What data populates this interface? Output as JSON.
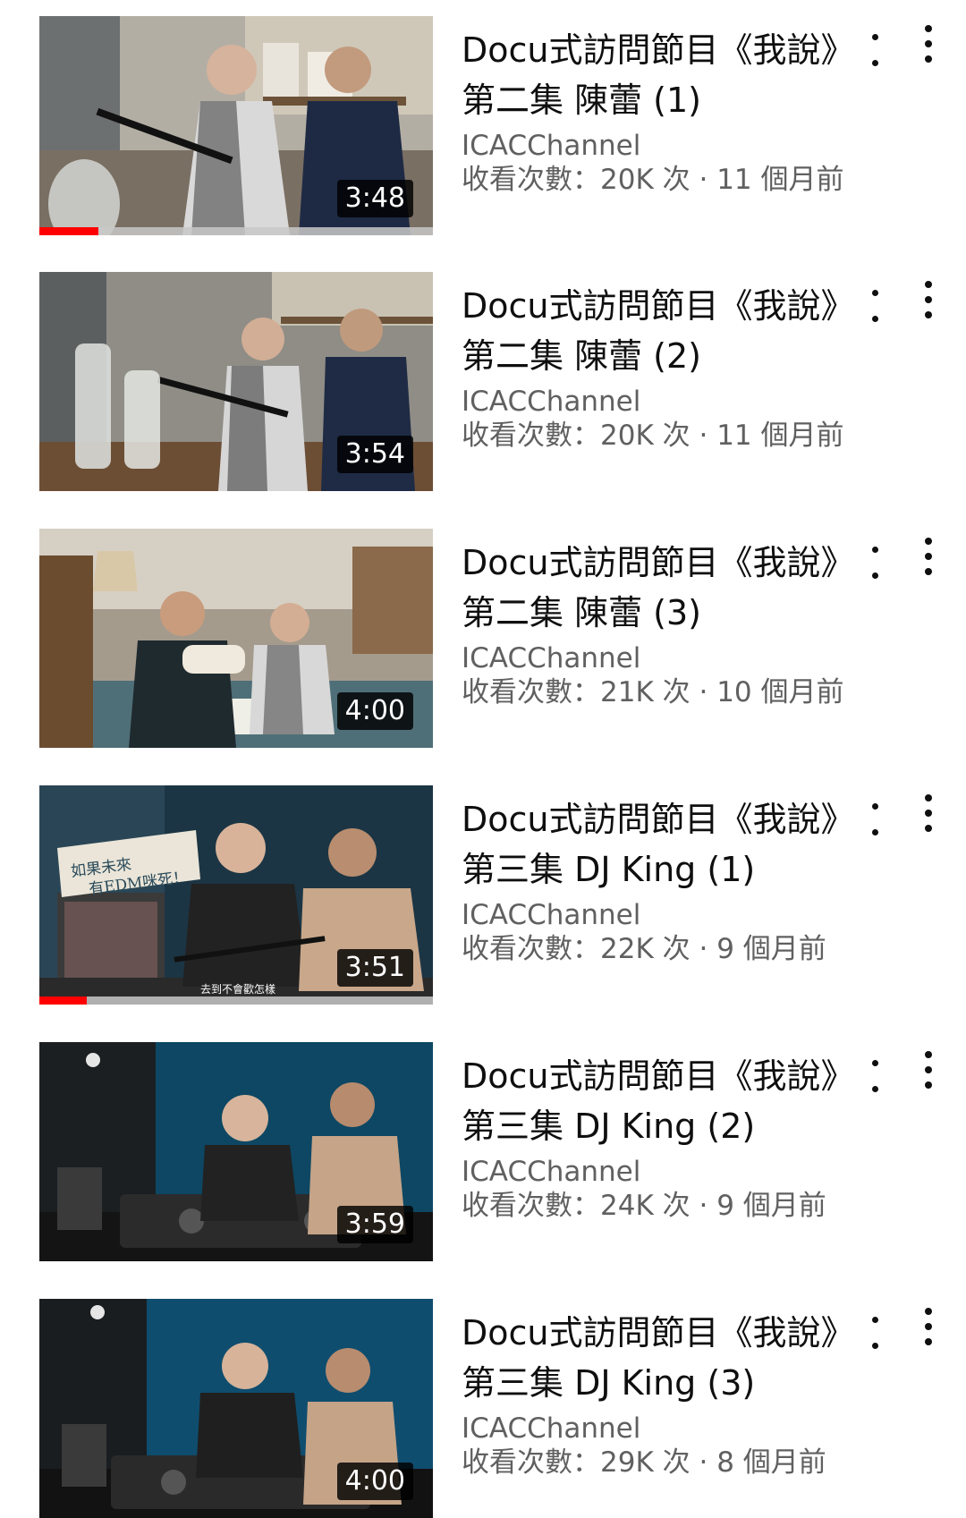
{
  "videos": [
    {
      "title_line1": "Docu式訪問節目《我說》",
      "title_line2": "第二集 陳蕾 (1)",
      "channel": "ICACChannel",
      "stats": "收看次數：20K 次 · 11 個月前",
      "duration": "3:48",
      "watched_fraction": 0.15,
      "thumbnail_palette": [
        "#b9b4a8",
        "#3a3a3a",
        "#dcd6cc"
      ]
    },
    {
      "title_line1": "Docu式訪問節目《我說》",
      "title_line2": "第二集 陳蕾 (2)",
      "channel": "ICACChannel",
      "stats": "收看次數：20K 次 · 11 個月前",
      "duration": "3:54",
      "watched_fraction": 0,
      "thumbnail_palette": [
        "#9a9890",
        "#2b2b2b",
        "#d5d0c4"
      ]
    },
    {
      "title_line1": "Docu式訪問節目《我說》",
      "title_line2": "第二集 陳蕾 (3)",
      "channel": "ICACChannel",
      "stats": "收看次數：21K 次 · 10 個月前",
      "duration": "4:00",
      "watched_fraction": 0,
      "thumbnail_palette": [
        "#8a7f70",
        "#2a2f33",
        "#e8e2d6"
      ]
    },
    {
      "title_line1": "Docu式訪問節目《我說》",
      "title_line2": "第三集 DJ King (1)",
      "channel": "ICACChannel",
      "stats": "收看次數：22K 次 · 9 個月前",
      "duration": "3:51",
      "watched_fraction": 0.12,
      "thumbnail_palette": [
        "#1f3a4a",
        "#222222",
        "#c8a88a"
      ]
    },
    {
      "title_line1": "Docu式訪問節目《我說》",
      "title_line2": "第三集 DJ King (2)",
      "channel": "ICACChannel",
      "stats": "收看次數：24K 次 · 9 個月前",
      "duration": "3:59",
      "watched_fraction": 0,
      "thumbnail_palette": [
        "#0e4a66",
        "#1a1a1a",
        "#b89a80"
      ]
    },
    {
      "title_line1": "Docu式訪問節目《我說》",
      "title_line2": "第三集 DJ King (3)",
      "channel": "ICACChannel",
      "stats": "收看次數：29K 次 · 8 個月前",
      "duration": "4:00",
      "watched_fraction": 0,
      "thumbnail_palette": [
        "#0f4e70",
        "#1b1b1b",
        "#b89a80"
      ]
    }
  ],
  "thumbnail_overlay_text": {
    "video_3_caption": "如果未來有EDM咪死！",
    "video_3_subtitle": "去到不會歡怎樣"
  },
  "colors": {
    "progress": "#ff0000",
    "secondary_text": "#606060",
    "primary_text": "#0f0f0f"
  },
  "icons": {
    "overflow_menu": "more-vert-icon"
  }
}
